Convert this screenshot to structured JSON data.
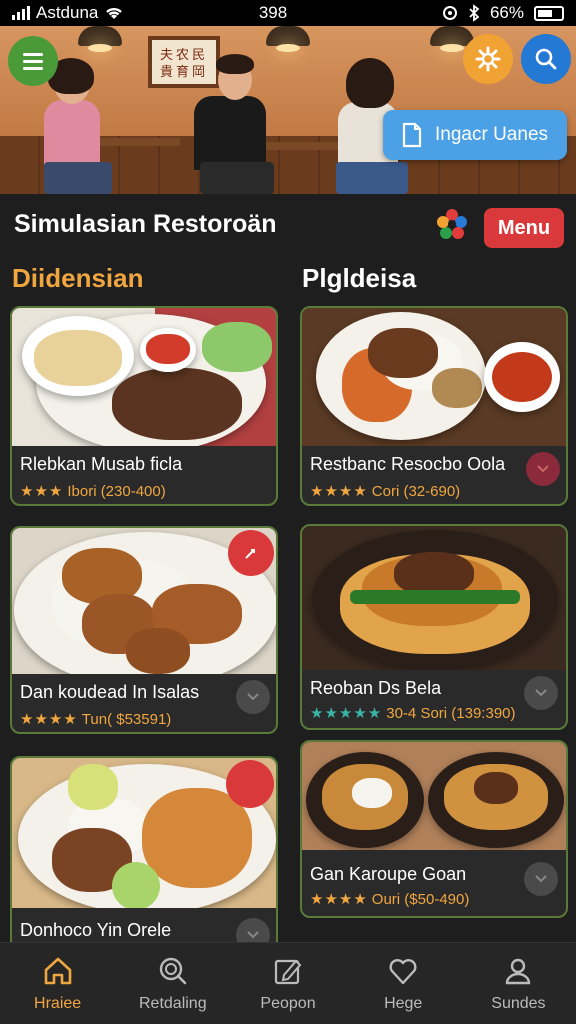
{
  "status_bar": {
    "carrier": "Astduna",
    "time": "398",
    "battery": "66%"
  },
  "hero": {
    "cta_label": "Ingacr Uanes",
    "frame_text": "夫农民 貴育岡"
  },
  "header": {
    "title": "Simulasian Restoroän",
    "menu_button": "Menu"
  },
  "sections": {
    "left": "Diidensian",
    "right": "Plgldeisa"
  },
  "cards": [
    {
      "name": "Rlebkan Musab ficla",
      "stars": "★★★",
      "meta": "Ibori (230-400)",
      "star_color": "#f0a640"
    },
    {
      "name": "Restbanc Resocbo Oola",
      "stars": "★★★★",
      "meta": "Cori (32-690)",
      "star_color": "#f0a640"
    },
    {
      "name": "Dan koudead In Isalas",
      "stars": "★★★★",
      "meta": "Tun( $53591)",
      "star_color": "#f0a640"
    },
    {
      "name": "Reoban Ds Bela",
      "stars": "★★★★★",
      "meta": "30-4 Sori (139:390)",
      "star_color": "#3bb3a4"
    },
    {
      "name": "Donhoco Yin Orele",
      "stars": "",
      "meta": "",
      "star_color": "#f0a640"
    },
    {
      "name": "Gan Karoupe Goan",
      "stars": "★★★★",
      "meta": "Ouri ($50-490)",
      "star_color": "#f0a640"
    }
  ],
  "nav": [
    {
      "label": "Hraiee",
      "icon": "home-icon",
      "active": true
    },
    {
      "label": "Retdaling",
      "icon": "search-icon",
      "active": false
    },
    {
      "label": "Peopon",
      "icon": "edit-icon",
      "active": false
    },
    {
      "label": "Hege",
      "icon": "heart-icon",
      "active": false
    },
    {
      "label": "Sundes",
      "icon": "user-icon",
      "active": false
    }
  ],
  "colors": {
    "accent_orange": "#f0a640",
    "menu_red": "#d9393b",
    "cta_blue": "#4ba0e6",
    "hamburger_green": "#4a9a3a",
    "gear_orange": "#f0a232",
    "search_blue": "#2479d4"
  }
}
